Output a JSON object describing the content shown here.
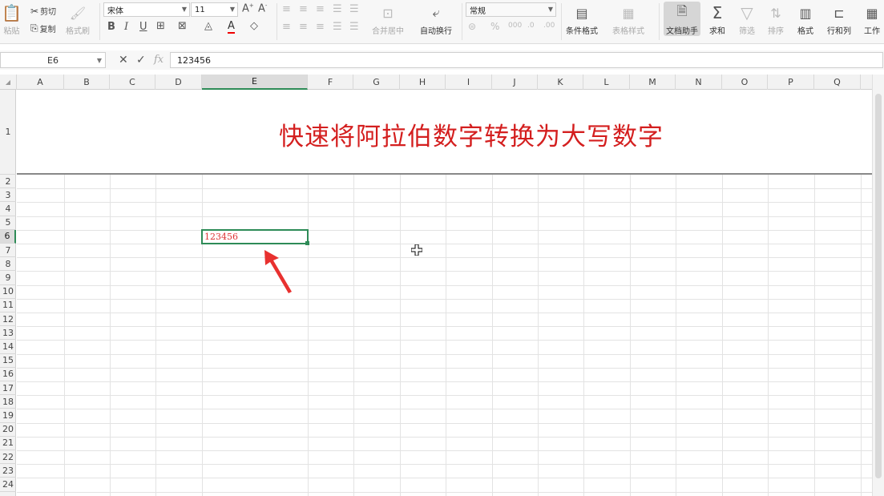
{
  "ribbon": {
    "paste": "粘贴",
    "cut": "剪切",
    "copy": "复制",
    "format_painter": "格式刷",
    "font_name": "宋体",
    "font_size": "11",
    "merge_center": "合并居中",
    "wrap_text": "自动换行",
    "number_format": "常规",
    "conditional_format": "条件格式",
    "table_style": "表格样式",
    "doc_assistant": "文档助手",
    "sum": "求和",
    "filter": "筛选",
    "sort": "排序",
    "format": "格式",
    "rows_cols": "行和列",
    "worksheet": "工作"
  },
  "formula_bar": {
    "name_box": "E6",
    "formula": "123456"
  },
  "grid": {
    "columns": [
      "A",
      "B",
      "C",
      "D",
      "E",
      "F",
      "G",
      "H",
      "I",
      "J",
      "K",
      "L",
      "M",
      "N",
      "O",
      "P",
      "Q"
    ],
    "rows": [
      "1",
      "2",
      "3",
      "4",
      "5",
      "6",
      "7",
      "8",
      "9",
      "10",
      "11",
      "12",
      "13",
      "14",
      "15",
      "16",
      "17",
      "18",
      "19",
      "20",
      "21",
      "22",
      "23",
      "24"
    ],
    "selected_column": "E",
    "selected_row": "6"
  },
  "sheet": {
    "title": "快速将阿拉伯数字转换为大写数字",
    "active_cell_value": "123456"
  },
  "colors": {
    "title": "#d41f1f",
    "selection": "#2e8b57",
    "arrow": "#e8312f"
  }
}
